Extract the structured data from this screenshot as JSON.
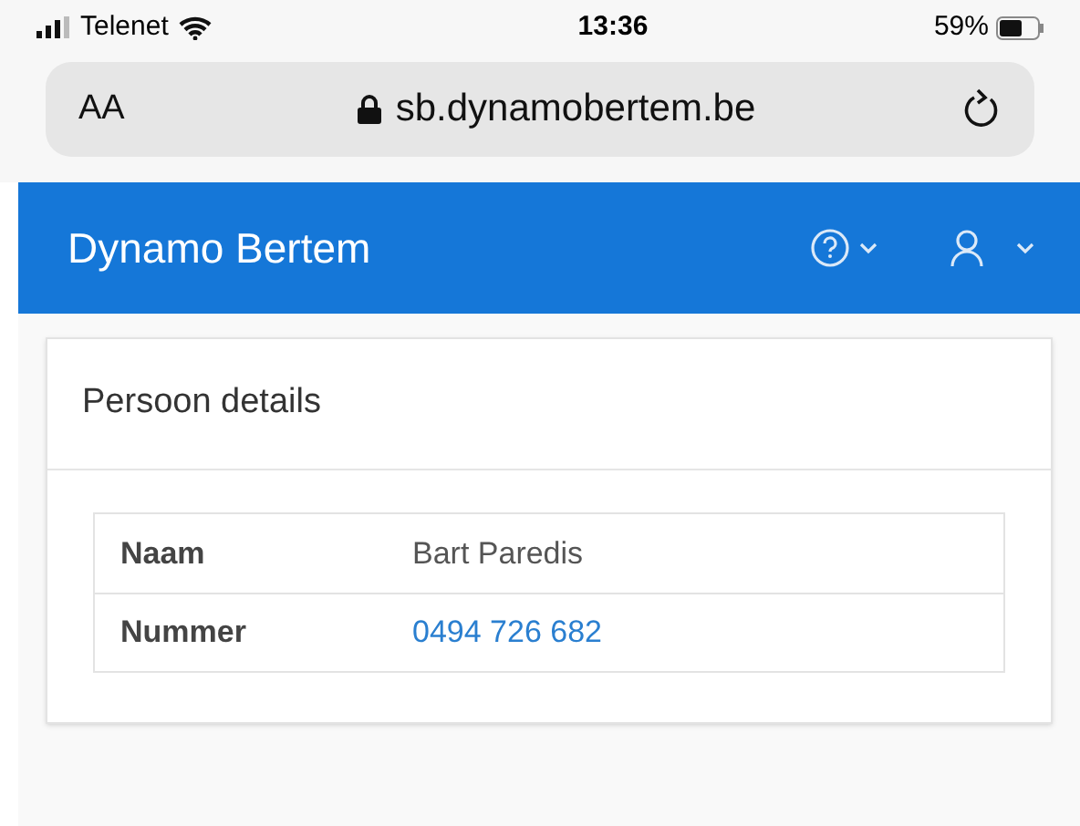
{
  "status_bar": {
    "carrier": "Telenet",
    "time": "13:36",
    "battery": "59%"
  },
  "address_bar": {
    "text_size_button": "AA",
    "url": "sb.dynamobertem.be"
  },
  "navbar": {
    "brand": "Dynamo Bertem"
  },
  "card": {
    "title": "Persoon details",
    "rows": [
      {
        "label": "Naam",
        "value": "Bart Paredis",
        "kind": "text"
      },
      {
        "label": "Nummer",
        "value": "0494 726 682",
        "kind": "link"
      }
    ]
  }
}
